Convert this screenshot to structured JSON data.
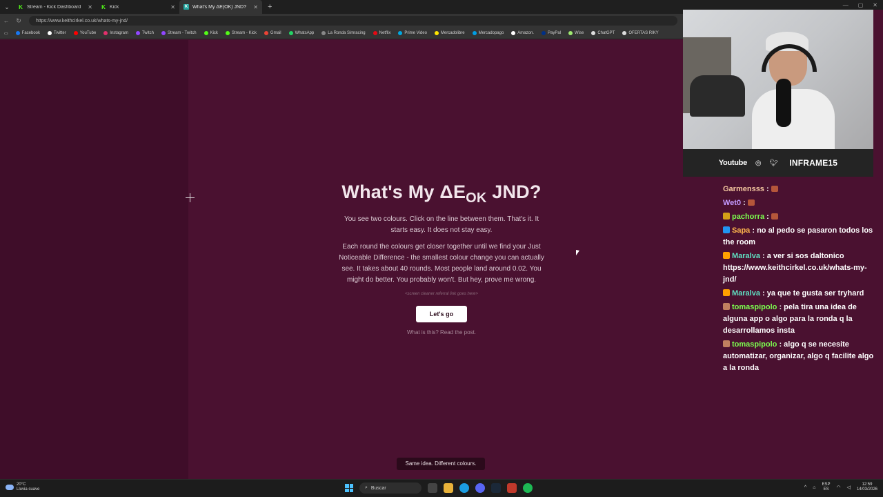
{
  "browser": {
    "tabs": [
      {
        "title": "Stream - Kick Dashboard",
        "icon": "kick-icon",
        "active": false
      },
      {
        "title": "Kick",
        "icon": "kick-icon",
        "active": false
      },
      {
        "title": "What's My ΔE(OK) JND?",
        "icon": "kc-icon",
        "active": true
      }
    ],
    "new_tab": "+",
    "url": "https://www.keithcirkel.co.uk/whats-my-jnd/",
    "bookmarks": [
      {
        "label": "Facebook",
        "color": "#1877f2"
      },
      {
        "label": "Twitter",
        "color": "#ffffff"
      },
      {
        "label": "YouTube",
        "color": "#ff0000"
      },
      {
        "label": "Instagram",
        "color": "#e1306c"
      },
      {
        "label": "Twitch",
        "color": "#9146ff"
      },
      {
        "label": "Stream - Twitch",
        "color": "#9146ff"
      },
      {
        "label": "Kick",
        "color": "#53fc18"
      },
      {
        "label": "Stream - Kick",
        "color": "#53fc18"
      },
      {
        "label": "Gmail",
        "color": "#ea4335"
      },
      {
        "label": "WhatsApp",
        "color": "#25d366"
      },
      {
        "label": "La Ronda Simracing",
        "color": "#888888"
      },
      {
        "label": "Netflix",
        "color": "#e50914"
      },
      {
        "label": "Prime Video",
        "color": "#00a8e1"
      },
      {
        "label": "Mercadolibre",
        "color": "#ffe600"
      },
      {
        "label": "Mercadopago",
        "color": "#009ee3"
      },
      {
        "label": "Amazon.",
        "color": "#ffffff"
      },
      {
        "label": "PayPal",
        "color": "#003087"
      },
      {
        "label": "Wise",
        "color": "#9fe870"
      },
      {
        "label": "ChatGPT",
        "color": "#dddddd"
      },
      {
        "label": "OFERTAS RIKY",
        "color": "#dddddd"
      }
    ]
  },
  "page": {
    "heading_main": "What's My ΔE",
    "heading_sub": "OK",
    "heading_end": " JND?",
    "para1": "You see two colours. Click on the line between them. That's it. It starts easy. It does not stay easy.",
    "para2": "Each round the colours get closer together until we find your Just Noticeable Difference - the smallest colour change you can actually see. It takes about 40 rounds. Most people land around 0.02. You might do better. You probably won't. But hey, prove me wrong.",
    "referral": "<screen cleaner referral link goes here>",
    "cta": "Let's go",
    "read_post": "What is this? Read the post.",
    "toast": "Same idea. Different colours."
  },
  "overlay": {
    "socials": {
      "youtube": "Youtube",
      "handle": "INFRAME15"
    },
    "chat": [
      {
        "user": "Garmensss",
        "color": "#f5c8a0",
        "badge": "",
        "text": " : ",
        "emote": true
      },
      {
        "user": "Wet0",
        "color": "#c49bff",
        "badge": "",
        "text": " : ",
        "emote": true
      },
      {
        "user": "pachorra",
        "color": "#7cff4f",
        "badge": "#d4a017",
        "text": " : ",
        "emote": true
      },
      {
        "user": "Sapa",
        "color": "#ffb74d",
        "badge": "#2196f3",
        "text": " : no al pedo se pasaron todos los the room",
        "emote": false
      },
      {
        "user": "Maralva",
        "color": "#5fe0c2",
        "badge": "#ffa000",
        "text": " : a ver si sos daltonico https://www.keithcirkel.co.uk/whats-my-jnd/",
        "emote": false
      },
      {
        "user": "Maralva",
        "color": "#5fe0c2",
        "badge": "#ffa000",
        "text": " : ya que te gusta ser tryhard",
        "emote": false
      },
      {
        "user": "tomaspipolo",
        "color": "#7cff4f",
        "badge": "#c08060",
        "text": " : pela tira una idea de alguna app o algo para la ronda q la desarrollamos insta",
        "emote": false
      },
      {
        "user": "tomaspipolo",
        "color": "#7cff4f",
        "badge": "#c08060",
        "text": " : algo q se necesite automatizar, organizar, algo q facilite algo a la ronda",
        "emote": false
      }
    ]
  },
  "taskbar": {
    "weather_temp": "20°C",
    "weather_desc": "Lluvia suave",
    "search": "Buscar",
    "lang_top": "ESP",
    "lang_bottom": "ES",
    "time": "12:59",
    "date": "14/03/2026"
  }
}
